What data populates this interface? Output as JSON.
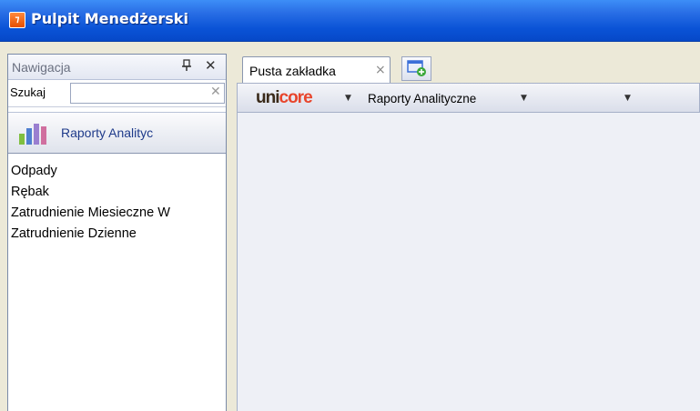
{
  "app": {
    "title": "Pulpit Menedżerski",
    "icon": "app-icon"
  },
  "nav": {
    "title": "Nawigacja",
    "pin_icon": "pin-icon",
    "close_icon": "close-icon",
    "search_label": "Szukaj",
    "search_value": "",
    "group": {
      "label": "Raporty Analityc",
      "icon": "bar-chart-icon"
    },
    "items": [
      {
        "label": "Odpady"
      },
      {
        "label": "Rębak"
      },
      {
        "label": "Zatrudnienie Miesieczne W"
      },
      {
        "label": "Zatrudnienie Dzienne"
      }
    ]
  },
  "tabs": [
    {
      "label": "Pusta zakładka",
      "close_icon": "close-icon"
    }
  ],
  "toolbar": {
    "logo_part1": "uni",
    "logo_part2": "core",
    "menu_label": "Raporty Analityczne"
  },
  "colors": {
    "titlebar": "#0a53d6",
    "group_label": "#1e3a8a",
    "logo_dark": "#3a2a1a",
    "logo_accent": "#e8452c"
  }
}
